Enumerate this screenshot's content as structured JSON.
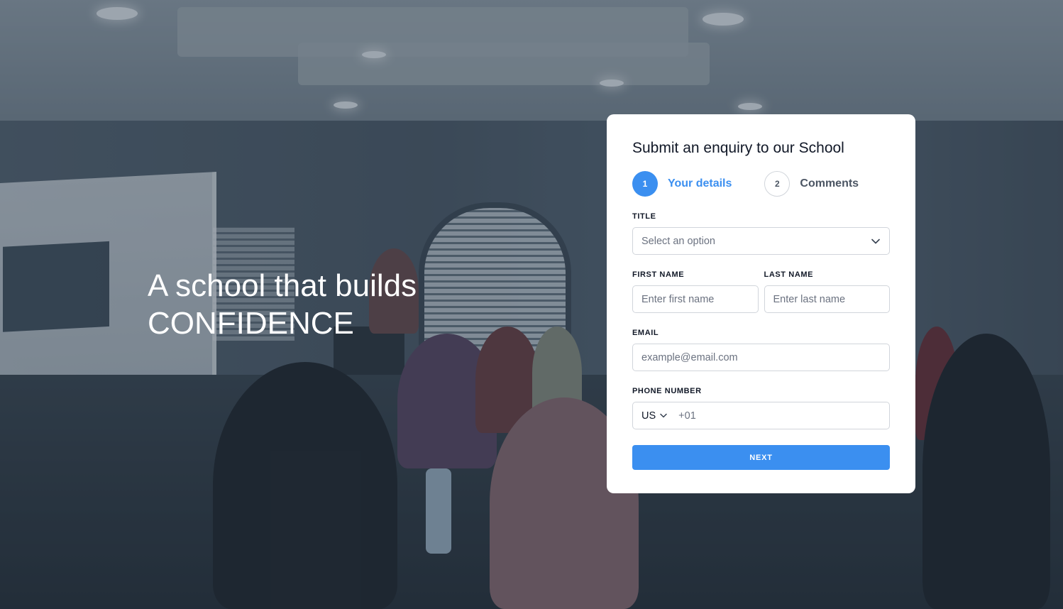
{
  "hero": {
    "line1": "A school that builds",
    "line2": "CONFIDENCE"
  },
  "form": {
    "title": "Submit an enquiry to our School",
    "steps": [
      {
        "number": "1",
        "label": "Your details",
        "state": "active"
      },
      {
        "number": "2",
        "label": "Comments",
        "state": "inactive"
      }
    ],
    "title_field": {
      "label": "TITLE",
      "value": "Select an option"
    },
    "first_name": {
      "label": "FIRST NAME",
      "placeholder": "Enter first name"
    },
    "last_name": {
      "label": "LAST NAME",
      "placeholder": "Enter last name"
    },
    "email": {
      "label": "EMAIL",
      "placeholder": "example@email.com"
    },
    "phone": {
      "label": "PHONE NUMBER",
      "country": "US",
      "placeholder": "+01"
    },
    "next_label": "NEXT"
  },
  "colors": {
    "accent": "#3b8ff0",
    "card_bg": "#ffffff",
    "text_dark": "#111827",
    "text_muted": "#6b7280"
  },
  "icons": {
    "select_chevron": "chevron-down-icon",
    "country_chevron": "chevron-down-icon"
  }
}
